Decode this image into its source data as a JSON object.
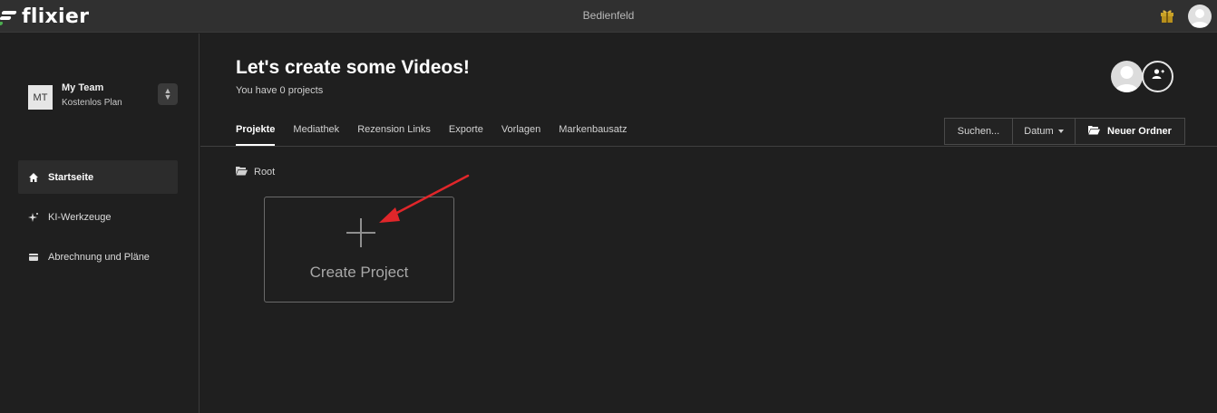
{
  "app": {
    "logo_text": "flixier",
    "window_title": "Bedienfeld"
  },
  "team": {
    "initials": "MT",
    "name": "My Team",
    "plan": "Kostenlos Plan"
  },
  "sidebar": {
    "items": [
      {
        "label": "Startseite",
        "icon": "home-icon",
        "active": true
      },
      {
        "label": "KI-Werkzeuge",
        "icon": "sparkle-icon",
        "active": false
      },
      {
        "label": "Abrechnung und Pläne",
        "icon": "wallet-icon",
        "active": false
      }
    ]
  },
  "header": {
    "title": "Let's create some Videos!",
    "subtitle": "You have 0 projects"
  },
  "tabs": [
    {
      "label": "Projekte",
      "active": true
    },
    {
      "label": "Mediathek",
      "active": false
    },
    {
      "label": "Rezension Links",
      "active": false
    },
    {
      "label": "Exporte",
      "active": false
    },
    {
      "label": "Vorlagen",
      "active": false
    },
    {
      "label": "Markenbausatz",
      "active": false
    }
  ],
  "toolbar": {
    "search_label": "Suchen...",
    "date_label": "Datum",
    "new_folder_label": "Neuer Ordner"
  },
  "breadcrumb": {
    "root_label": "Root"
  },
  "create_card": {
    "label": "Create Project"
  },
  "colors": {
    "background": "#1f1f1f",
    "topbar": "#303030",
    "annotation_arrow": "#e0262a",
    "logo_accent": "#4caf50",
    "gift": "#c9a227"
  }
}
